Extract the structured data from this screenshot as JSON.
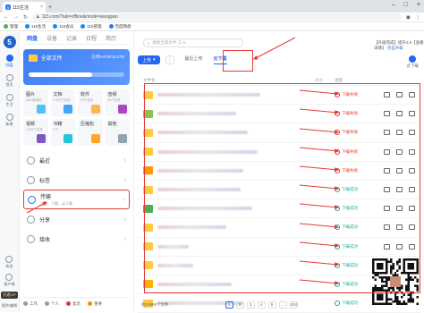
{
  "browser": {
    "tab_title": "115生活",
    "url": "115.com/?tab=offline&mode=wangpan",
    "bookmarks": [
      {
        "label": "管理",
        "color": "#4caf50"
      },
      {
        "label": "115生活",
        "color": "#1e88e5"
      },
      {
        "label": "115会员",
        "color": "#1e88e5"
      },
      {
        "label": "115管理",
        "color": "#1e88e5"
      },
      {
        "label": "百度网盘",
        "color": "#2979ff"
      }
    ]
  },
  "rail": {
    "logo": "5",
    "items": [
      {
        "label": "网盘",
        "icon": "cloud-icon",
        "active": true
      },
      {
        "label": "首页",
        "icon": "home-icon",
        "active": false
      },
      {
        "label": "生活",
        "icon": "life-icon",
        "active": false
      },
      {
        "label": "新建",
        "icon": "plus-icon",
        "active": false
      }
    ],
    "bottom": [
      {
        "label": "私信",
        "icon": "message-icon"
      },
      {
        "label": "客户端",
        "icon": "client-icon"
      }
    ],
    "vip_label": "开通VIP",
    "user_label": "昵称/编辑"
  },
  "sidebar": {
    "tabs": [
      "网盘",
      "设备",
      "记录",
      "日程",
      "简历"
    ],
    "all_files": {
      "label": "全部文件",
      "quota": "已用9.9TB/15.0TB",
      "used_ratio": 0.66
    },
    "categories": [
      {
        "label": "图片",
        "sub": "3213张照片",
        "color": "#4fc3f7"
      },
      {
        "label": "文档",
        "sub": "1.3万个文件",
        "color": "#42a5f5"
      },
      {
        "label": "软件",
        "sub": "33个文件",
        "color": "#ffb74d"
      },
      {
        "label": "音频",
        "sub": "40个文件",
        "color": "#ab47bc"
      },
      {
        "label": "视频",
        "sub": "1.5万个文件",
        "color": "#7e57c2"
      },
      {
        "label": "书籍",
        "sub": "1个",
        "color": "#26c6da"
      },
      {
        "label": "压缩包",
        "sub": "",
        "color": "#ffa726"
      },
      {
        "label": "其他",
        "sub": "",
        "color": "#90a4ae"
      }
    ],
    "menu": [
      {
        "label": "最近",
        "sub": "",
        "icon": "clock-icon"
      },
      {
        "label": "标签",
        "sub": "",
        "icon": "tag-icon"
      },
      {
        "label": "传输",
        "sub": "上传、下载、云下载",
        "icon": "transfer-icon",
        "highlight": true
      },
      {
        "label": "分享",
        "sub": "",
        "icon": "share-icon"
      },
      {
        "label": "接收",
        "sub": "",
        "icon": "receive-icon"
      }
    ],
    "footer": [
      "工作",
      "个人",
      "紧急",
      "重要"
    ]
  },
  "main": {
    "search_placeholder": "搜索全部文件 ⌘ K",
    "notice": "【升级完成】提升3.0【查看详情】",
    "notice_link": "点击升级",
    "upload_label": "上传",
    "tabs": [
      {
        "label": "最近上传",
        "active": false
      },
      {
        "label": "云下载",
        "active": true
      }
    ],
    "right_button": "云下载",
    "columns": {
      "name": "文件名",
      "size": "大小",
      "status": "进度"
    },
    "rows": [
      {
        "status": "下载失败",
        "state": "fail",
        "w": 0.72
      },
      {
        "status": "下载失败",
        "state": "fail",
        "w": 0.55
      },
      {
        "status": "下载失败",
        "state": "fail",
        "w": 0.63
      },
      {
        "status": "下载失败",
        "state": "fail",
        "w": 0.7
      },
      {
        "status": "下载失败",
        "state": "fail",
        "w": 0.6
      },
      {
        "status": "下载成功",
        "state": "ok",
        "w": 0.58
      },
      {
        "status": "下载成功",
        "state": "ok",
        "w": 0.66
      },
      {
        "status": "下载成功",
        "state": "ok",
        "w": 0.48
      },
      {
        "status": "下载成功",
        "state": "ok",
        "w": 0.22
      },
      {
        "status": "下载成功",
        "state": "ok",
        "w": 0.25
      },
      {
        "status": "下载成功",
        "state": "ok",
        "w": 0.52
      },
      {
        "status": "下载成功",
        "state": "ok",
        "w": 0.6
      }
    ],
    "pager": {
      "total": "共10869个文件",
      "pages": [
        "1",
        "2",
        "3",
        "4",
        "5",
        "...",
        "434"
      ],
      "current": "1"
    }
  },
  "colors": {
    "accent": "#2468f2",
    "fail": "#e53935",
    "ok": "#26a69a",
    "annotation": "#e53935"
  }
}
